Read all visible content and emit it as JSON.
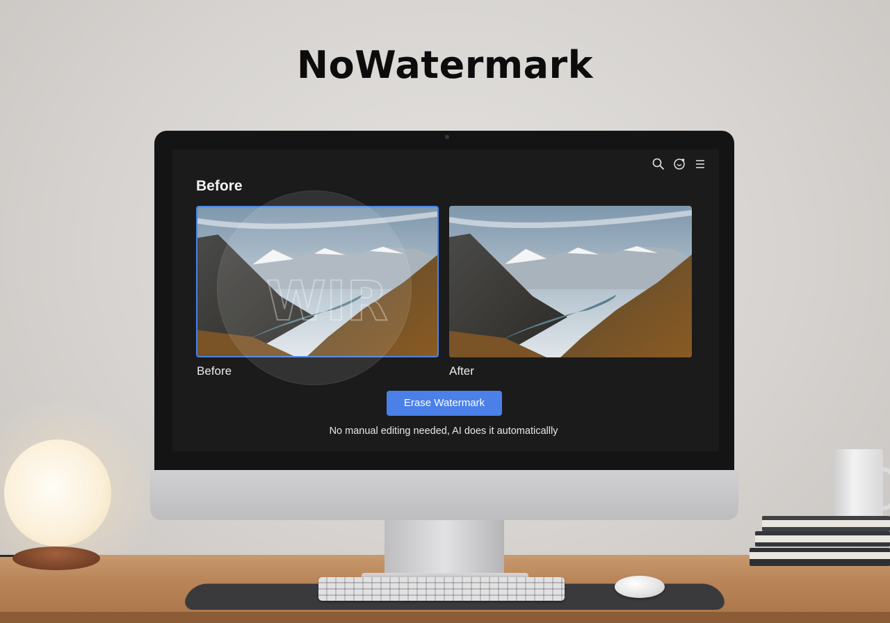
{
  "headline": "NoWatermark",
  "app": {
    "section_title": "Before",
    "toolbar": {
      "icons": [
        "search-icon",
        "history-icon",
        "menu-icon"
      ]
    },
    "before_caption": "Before",
    "after_caption": "After",
    "primary_button": "Erase Watermark",
    "note": "No manual editing needed, AI does it automaticallly",
    "accent_color": "#4a80e8"
  }
}
